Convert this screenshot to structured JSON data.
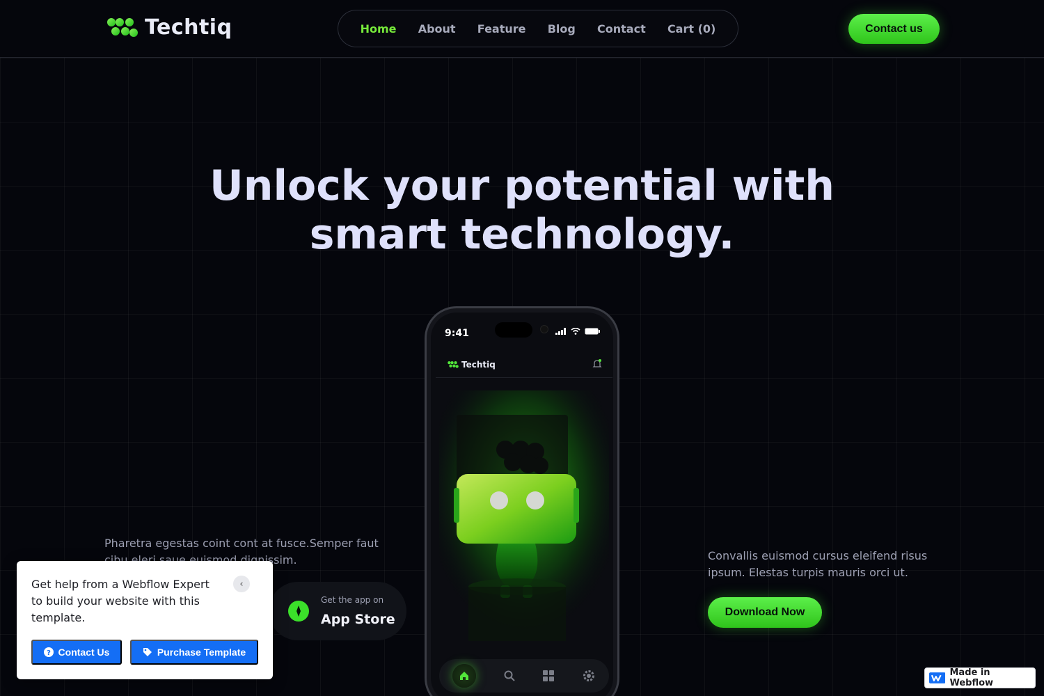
{
  "brand": {
    "name": "Techtiq",
    "accent": "#52e63a"
  },
  "nav": {
    "items": [
      {
        "label": "Home",
        "active": true
      },
      {
        "label": "About",
        "active": false
      },
      {
        "label": "Feature",
        "active": false
      },
      {
        "label": "Blog",
        "active": false
      },
      {
        "label": "Contact",
        "active": false
      },
      {
        "label": "Cart (0)",
        "active": false
      }
    ],
    "cta": "Contact us"
  },
  "hero": {
    "title_line1": "Unlock your potential with",
    "title_line2": "smart technology.",
    "left_text": "Pharetra egestas coint cont at fusce.Semper faut cibu eleri saue euismod dignissim.",
    "right_text": "Convallis euismod cursus eleifend risus ipsum. Elestas turpis mauris orci ut.",
    "download_label": "Download Now"
  },
  "appstore": {
    "small": "Get the app on",
    "big": "App Store"
  },
  "phone": {
    "time": "9:41",
    "brand": "Techtiq",
    "tabs": [
      "home-icon",
      "search-icon",
      "grid-icon",
      "settings-icon"
    ]
  },
  "help_card": {
    "text": "Get help from a Webflow Expert to build your website with this template.",
    "contact_label": "Contact Us",
    "purchase_label": "Purchase Template",
    "button_color": "#146ef5"
  },
  "badge": {
    "label": "Made in Webflow"
  }
}
